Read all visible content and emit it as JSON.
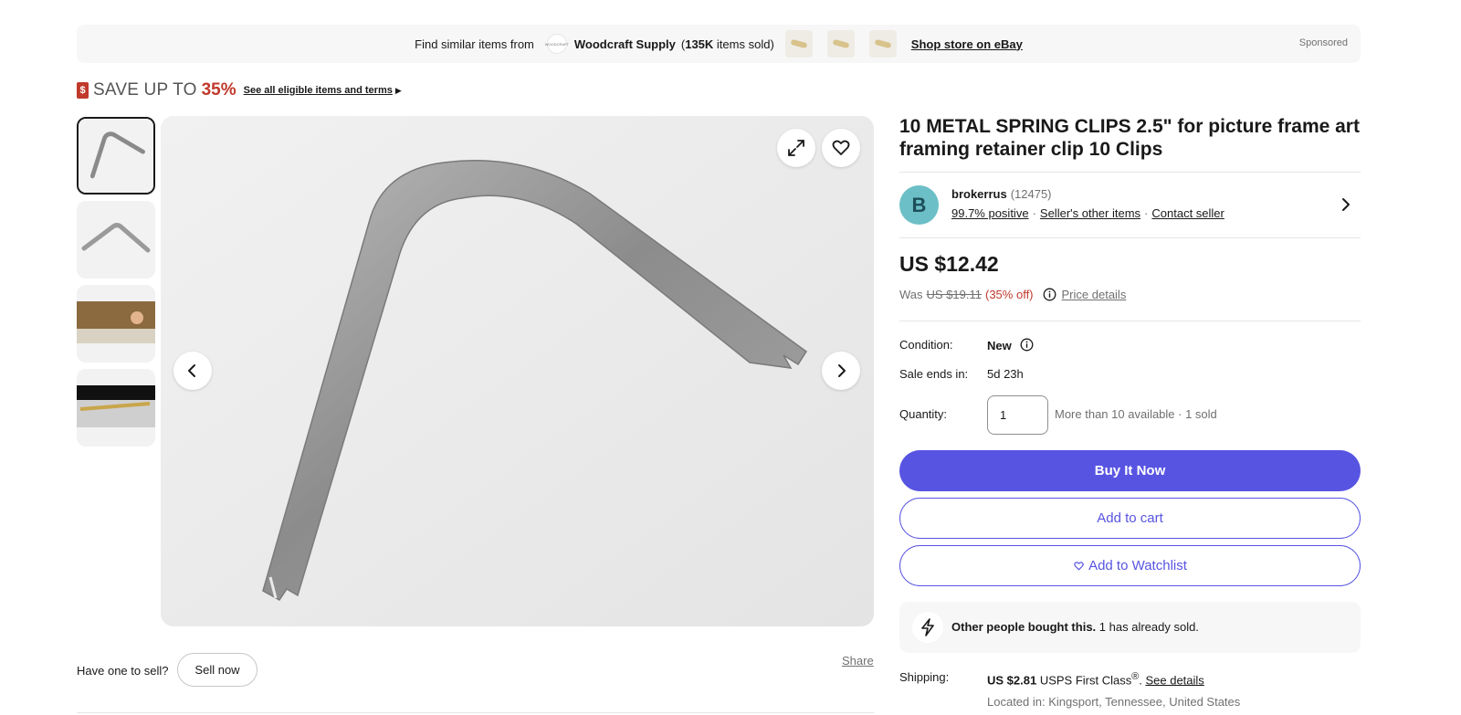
{
  "banner": {
    "find_text": "Find similar items from",
    "store_logo_text": "WOODCRAFT",
    "store_name": "Woodcraft Supply",
    "sold_open": "(",
    "sold_count": "135K",
    "sold_rest": "items sold)",
    "shop_link": "Shop store on eBay",
    "sponsored": "Sponsored"
  },
  "save": {
    "icon": "$",
    "text": "SAVE UP TO",
    "percent": "35%",
    "link": "See all eligible items and terms"
  },
  "gallery": {
    "thumbnails": [
      "thumbnail-1",
      "thumbnail-2",
      "thumbnail-3",
      "thumbnail-4"
    ]
  },
  "below_image": {
    "have_one": "Have one to sell?",
    "sell_now": "Sell now",
    "share": "Share"
  },
  "listing": {
    "title": "10 METAL SPRING CLIPS 2.5\" for picture frame art framing retainer clip 10 Clips",
    "seller": {
      "initial": "B",
      "name": "brokerrus",
      "feedback_count": "(12475)",
      "positive": "99.7% positive",
      "other_items": "Seller's other items",
      "contact": "Contact seller"
    },
    "price": "US $12.42",
    "was_label": "Was",
    "was_price": "US $19.11",
    "discount": "(35% off)",
    "price_details": "Price details",
    "condition_label": "Condition:",
    "condition_value": "New",
    "sale_ends_label": "Sale ends in:",
    "sale_ends_value": "5d 23h",
    "quantity_label": "Quantity:",
    "quantity_value": "1",
    "quantity_note": "More than 10 available · 1 sold",
    "buy_now": "Buy It Now",
    "add_to_cart": "Add to cart",
    "watchlist": "Add to Watchlist",
    "bought_bold": "Other people bought this.",
    "bought_rest": "1 has already sold.",
    "shipping_label": "Shipping:",
    "shipping_price": "US $2.81",
    "shipping_method": "USPS First Class",
    "shipping_reg": "®",
    "shipping_sep": ".",
    "shipping_link": "See details",
    "located": "Located in: Kingsport, Tennessee, United States"
  },
  "colors": {
    "primary": "#5854e2",
    "sale_red": "#c0392b",
    "avatar": "#6cbfc6"
  }
}
